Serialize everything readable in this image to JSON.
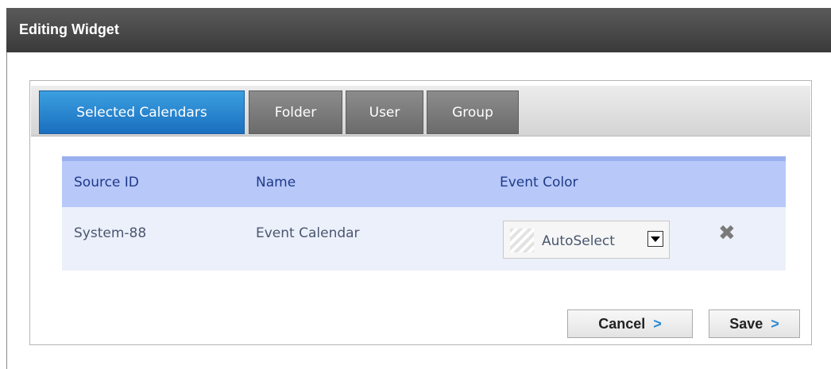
{
  "window": {
    "title": "Editing Widget"
  },
  "tabs": [
    {
      "label": "Selected Calendars",
      "active": true
    },
    {
      "label": "Folder",
      "active": false
    },
    {
      "label": "User",
      "active": false
    },
    {
      "label": "Group",
      "active": false
    }
  ],
  "table": {
    "headers": [
      "Source ID",
      "Name",
      "Event Color"
    ],
    "rows": [
      {
        "source_id": "System-88",
        "name": "Event Calendar",
        "event_color": "AutoSelect"
      }
    ]
  },
  "buttons": {
    "cancel": "Cancel",
    "save": "Save",
    "chevron": ">"
  },
  "icons": {
    "delete": "close-x-icon",
    "dropdown": "chevron-down-icon",
    "button_arrow": "chevron-right-icon"
  },
  "colors": {
    "active_tab": "#1a6fbf",
    "inactive_tab": "#7a7a7a",
    "header_bg": "#b8c8f8",
    "row_bg": "#ecf0fa",
    "title_bar": "#444444"
  }
}
